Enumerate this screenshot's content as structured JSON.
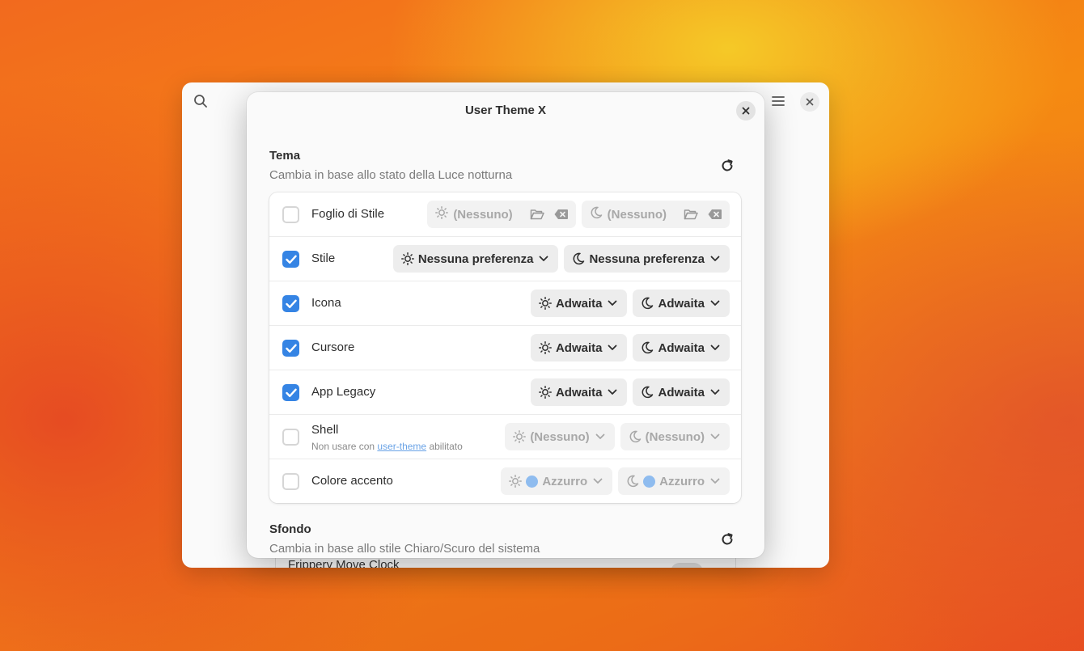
{
  "colors": {
    "accent": "#3584e4",
    "accent_swatch": "#8fbcef"
  },
  "background_window": {
    "partial_item_label": "Frippery Move Clock",
    "icons": [
      "search-icon",
      "hamburger-menu-icon",
      "close-icon"
    ]
  },
  "dialog": {
    "title": "User Theme X",
    "close_icon": "close-icon",
    "theme_section": {
      "title": "Tema",
      "subtitle": "Cambia in base allo stato della Luce notturna",
      "reset_icon": "refresh-icon"
    },
    "rows": [
      {
        "label": "Foglio di Stile",
        "checked": false,
        "light_value": "(Nessuno)",
        "dark_value": "(Nessuno)"
      },
      {
        "label": "Stile",
        "checked": true,
        "light_value": "Nessuna preferenza",
        "dark_value": "Nessuna preferenza"
      },
      {
        "label": "Icona",
        "checked": true,
        "light_value": "Adwaita",
        "dark_value": "Adwaita"
      },
      {
        "label": "Cursore",
        "checked": true,
        "light_value": "Adwaita",
        "dark_value": "Adwaita"
      },
      {
        "label": "App Legacy",
        "checked": true,
        "light_value": "Adwaita",
        "dark_value": "Adwaita"
      },
      {
        "label": "Shell",
        "checked": false,
        "subtitle_prefix": "Non usare con",
        "subtitle_link": "user-theme",
        "subtitle_suffix": "abilitato",
        "light_value": "(Nessuno)",
        "dark_value": "(Nessuno)"
      },
      {
        "label": "Colore accento",
        "checked": false,
        "light_value": "Azzurro",
        "dark_value": "Azzurro"
      }
    ],
    "wallpaper_section": {
      "title": "Sfondo",
      "subtitle": "Cambia in base allo stile Chiaro/Scuro del sistema",
      "reset_icon": "refresh-icon"
    }
  }
}
